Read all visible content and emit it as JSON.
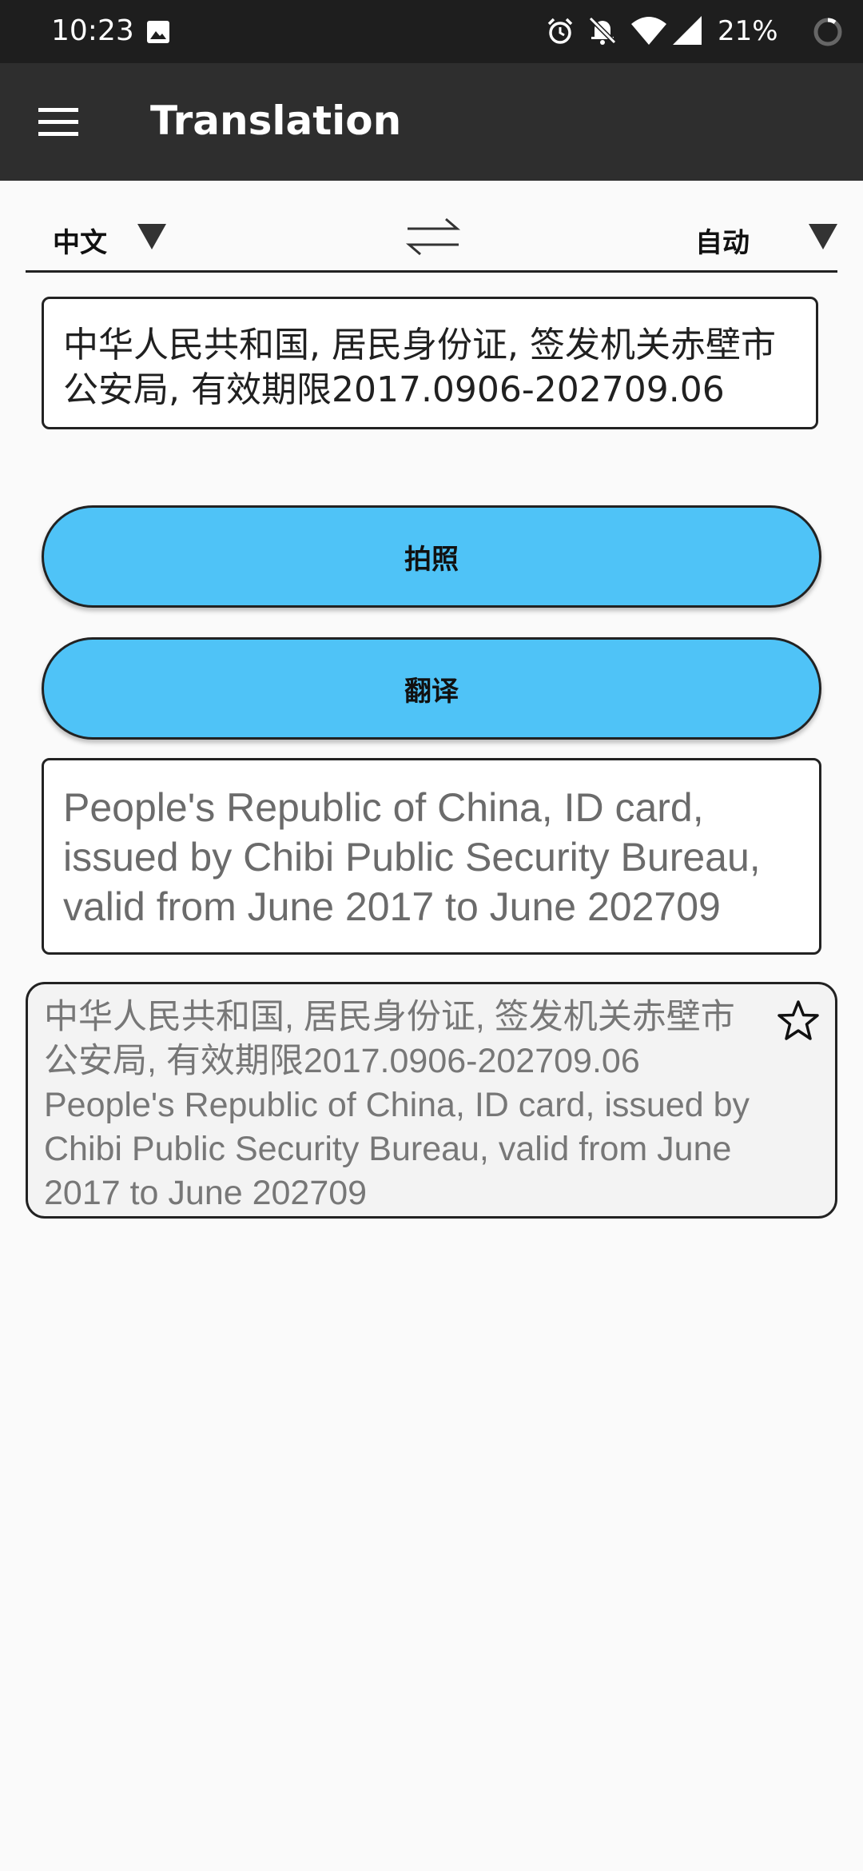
{
  "status_bar": {
    "time": "10:23",
    "battery": "21%",
    "icons": [
      "image-icon",
      "alarm-icon",
      "bell-off-icon",
      "wifi-icon",
      "signal-icon",
      "battery-circle-icon"
    ]
  },
  "app_bar": {
    "title": "Translation",
    "menu_icon": "hamburger-menu-icon"
  },
  "language_row": {
    "source_language": "中文",
    "target_language": "自动",
    "swap_icon": "swap-arrows-icon"
  },
  "source_text": "中华人民共和国, 居民身份证, 签发机关赤壁市公安局, 有效期限2017.0906-202709.06",
  "buttons": {
    "photo_label": "拍照",
    "translate_label": "翻译"
  },
  "result_text": "People's Republic of China, ID card, issued by Chibi Public Security Bureau, valid from June 2017 to June 202709",
  "history": [
    {
      "source": "中华人民共和国, 居民身份证, 签发机关赤壁市公安局, 有效期限2017.0906-202709.06",
      "translation": "People's Republic of China, ID card, issued by Chibi Public Security Bureau, valid from June 2017 to June 202709",
      "favorite": false
    }
  ],
  "colors": {
    "status_bar": "#1e1e1e",
    "app_bar": "#2e2e2e",
    "button_fill": "#4fc3f7",
    "background": "#fafafa"
  }
}
